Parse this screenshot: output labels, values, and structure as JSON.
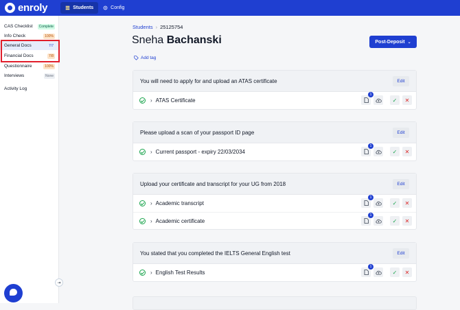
{
  "header": {
    "brand": "enroly",
    "tabs": [
      {
        "label": "Students"
      },
      {
        "label": "Config"
      }
    ]
  },
  "sidebar": {
    "items": [
      {
        "label": "CAS Checklist",
        "badge": "Complete"
      },
      {
        "label": "Info Check",
        "badge": "100%"
      },
      {
        "label": "General Docs",
        "badge": "7/7"
      },
      {
        "label": "Financial Docs",
        "badge": "7/8"
      },
      {
        "label": "Questionnaire",
        "badge": "100%"
      },
      {
        "label": "Interviews",
        "badge": "None"
      },
      {
        "label": "Activity Log",
        "badge": ""
      }
    ]
  },
  "breadcrumb": {
    "parent": "Students",
    "current": "25125754"
  },
  "student": {
    "first_name": "Sneha",
    "last_name": "Bachanski"
  },
  "add_tag_label": "Add tag",
  "status_button": "Post-Deposit",
  "edit_label": "Edit",
  "doc_badge_count": "1",
  "sections": [
    {
      "title": "You will need to apply for and upload an ATAS certificate",
      "rows": [
        "ATAS Certificate"
      ]
    },
    {
      "title": "Please upload a scan of your passport ID page",
      "rows": [
        "Current passport - expiry 22/03/2034"
      ]
    },
    {
      "title": "Upload your certificate and transcript for your UG from 2018",
      "rows": [
        "Academic transcript",
        "Academic certificate"
      ]
    },
    {
      "title": "You stated that you completed the IELTS General English test",
      "rows": [
        "English Test Results"
      ]
    }
  ],
  "colors": {
    "brand": "#1f3fd1",
    "highlight": "#e11d2a",
    "success": "#16a34a",
    "danger": "#dc2626"
  }
}
